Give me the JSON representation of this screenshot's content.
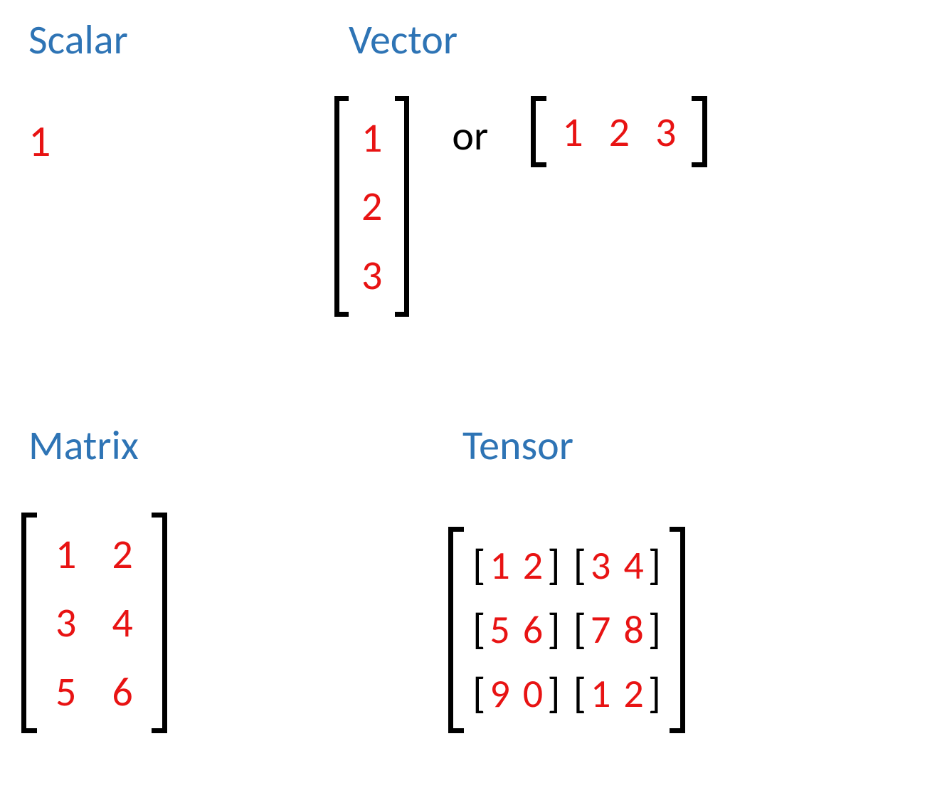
{
  "scalar": {
    "title": "Scalar",
    "value": "1"
  },
  "vector": {
    "title": "Vector",
    "column": [
      "1",
      "2",
      "3"
    ],
    "or": "or",
    "row": [
      "1",
      "2",
      "3"
    ]
  },
  "matrix": {
    "title": "Matrix",
    "rows": [
      [
        "1",
        "2"
      ],
      [
        "3",
        "4"
      ],
      [
        "5",
        "6"
      ]
    ]
  },
  "tensor": {
    "title": "Tensor",
    "rows": [
      [
        [
          "1",
          "2"
        ],
        [
          "3",
          "4"
        ]
      ],
      [
        [
          "5",
          "6"
        ],
        [
          "7",
          "8"
        ]
      ],
      [
        [
          "9",
          "0"
        ],
        [
          "1",
          "2"
        ]
      ]
    ]
  }
}
